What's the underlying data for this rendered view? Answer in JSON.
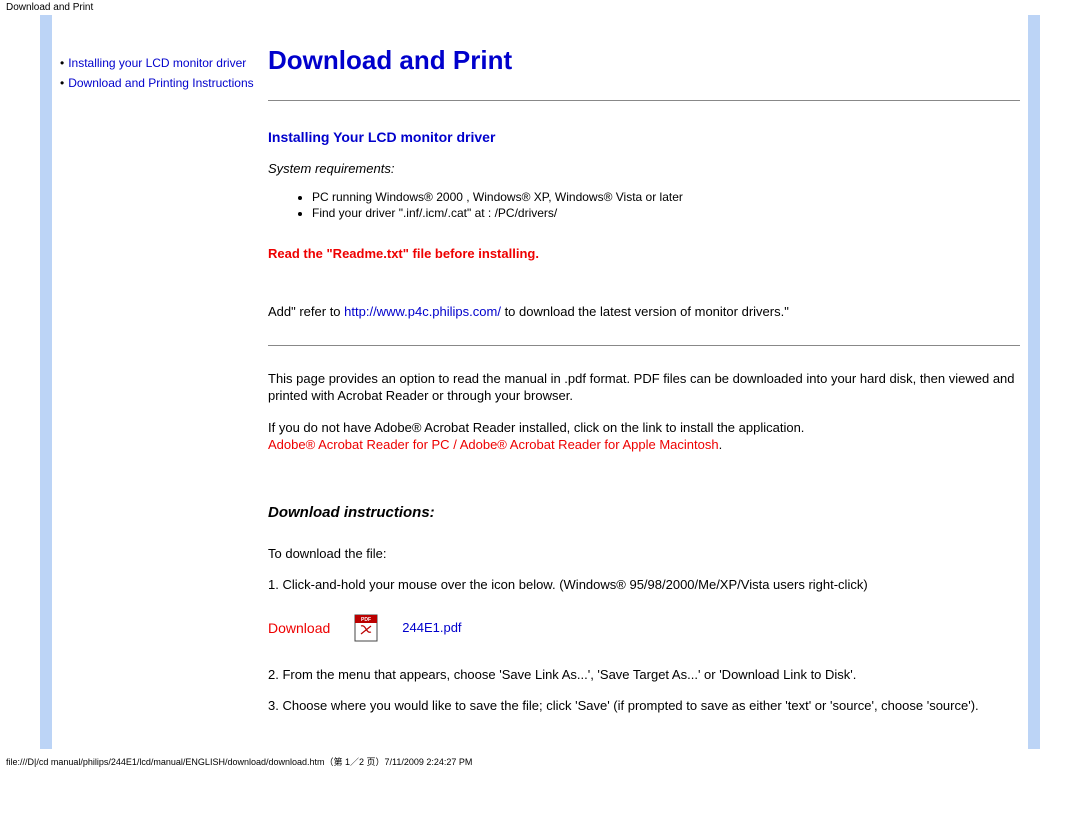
{
  "header_path": "Download and Print",
  "sidebar": {
    "items": [
      {
        "label": "Installing your LCD monitor driver"
      },
      {
        "label": "Download and Printing Instructions"
      }
    ]
  },
  "title": "Download and Print",
  "section1": {
    "heading": "Installing Your LCD monitor driver",
    "sysreq_label": "System requirements:",
    "reqs": [
      "PC running Windows® 2000 , Windows® XP, Windows® Vista or later",
      "Find your driver \".inf/.icm/.cat\" at : /PC/drivers/"
    ],
    "warn": "Read the \"Readme.txt\" file before installing.",
    "add_prefix": "Add\" refer to ",
    "add_link": "http://www.p4c.philips.com/",
    "add_suffix": " to download the latest version of monitor drivers.\""
  },
  "section2": {
    "p1": "This page provides an option to read the manual in .pdf format. PDF files can be downloaded into your hard disk, then viewed and printed with Acrobat Reader or through your browser.",
    "p2_prefix": "If you do not have Adobe® Acrobat Reader installed, click on the link to install the application.",
    "p2_link1": "Adobe® Acrobat Reader for PC",
    "p2_sep": " / ",
    "p2_link2": "Adobe® Acrobat Reader for Apple Macintosh",
    "p2_end": "."
  },
  "dl": {
    "heading": "Download instructions:",
    "p_intro": "To download the file:",
    "p_step1": "1. Click-and-hold your mouse over the icon below. (Windows® 95/98/2000/Me/XP/Vista users right-click)",
    "label": "Download",
    "file": "244E1.pdf",
    "p_step2": "2. From the menu that appears, choose 'Save Link As...', 'Save Target As...' or 'Download Link to Disk'.",
    "p_step3": "3. Choose where you would like to save the file; click 'Save' (if prompted to save as either 'text' or 'source', choose 'source')."
  },
  "footer": "file:///D|/cd manual/philips/244E1/lcd/manual/ENGLISH/download/download.htm（第 1／2 页）7/11/2009 2:24:27 PM"
}
